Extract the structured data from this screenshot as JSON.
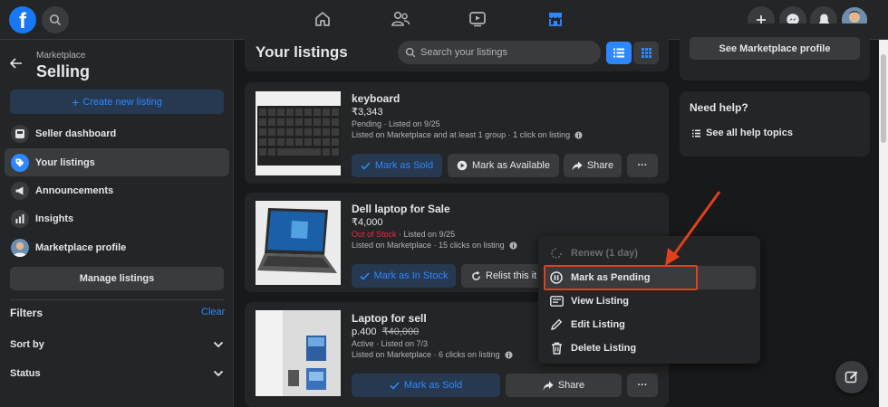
{
  "colors": {
    "accent": "#2d88ff",
    "bg": "#18191a",
    "surface": "#242526",
    "out_of_stock": "#f02849",
    "annotation": "#e0401a"
  },
  "nav": {
    "logo_letter": "f",
    "icons": [
      "search-icon",
      "home-icon",
      "friends-icon",
      "watch-icon",
      "marketplace-icon",
      "plus-icon",
      "messenger-icon",
      "bell-icon"
    ],
    "active_tab": "marketplace"
  },
  "sidebar": {
    "breadcrumb": "Marketplace",
    "title": "Selling",
    "create_label": "Create new listing",
    "items": [
      {
        "label": "Seller dashboard",
        "icon": "dashboard-icon"
      },
      {
        "label": "Your listings",
        "icon": "tag-icon"
      },
      {
        "label": "Announcements",
        "icon": "megaphone-icon"
      },
      {
        "label": "Insights",
        "icon": "chart-icon"
      },
      {
        "label": "Marketplace profile",
        "icon": "avatar"
      }
    ],
    "manage_label": "Manage listings",
    "filters_label": "Filters",
    "clear_label": "Clear",
    "sort_label": "Sort by",
    "status_label": "Status"
  },
  "main": {
    "title": "Your listings",
    "search_placeholder": "Search your listings",
    "listings": [
      {
        "title": "keyboard",
        "price": "₹3,343",
        "status": "Pending",
        "status_rest": " · Listed on 9/25",
        "info": "Listed on Marketplace and at least 1 group · 1 click on listing",
        "btn_primary": "Mark as Sold",
        "btn_secondary": "Mark as Available",
        "btn_share": "Share",
        "btn_more": "···"
      },
      {
        "title": "Dell laptop for Sale",
        "price": "₹4,000",
        "status": "Out of Stock",
        "status_rest": " · Listed on 9/25",
        "info": "Listed on Marketplace · 15 clicks on listing",
        "btn_primary": "Mark as In Stock",
        "btn_secondary": "Relist this it"
      },
      {
        "title": "Laptop for sell",
        "price": "p.400",
        "old_price": "₹40,000",
        "status": "Active",
        "status_rest": " · Listed on 7/3",
        "info": "Listed on Marketplace · 6 clicks on listing",
        "btn_primary": "Mark as Sold",
        "btn_share": "Share",
        "btn_more": "···"
      }
    ]
  },
  "right": {
    "see_profile": "See Marketplace profile",
    "help_title": "Need help?",
    "help_link": "See all help topics"
  },
  "menu": {
    "items": [
      {
        "label": "Renew (1 day)",
        "icon": "renew-icon",
        "disabled": true
      },
      {
        "label": "Mark as Pending",
        "icon": "pause-icon",
        "highlighted": true
      },
      {
        "label": "View Listing",
        "icon": "view-icon"
      },
      {
        "label": "Edit Listing",
        "icon": "pencil-icon"
      },
      {
        "label": "Delete Listing",
        "icon": "trash-icon"
      }
    ]
  }
}
